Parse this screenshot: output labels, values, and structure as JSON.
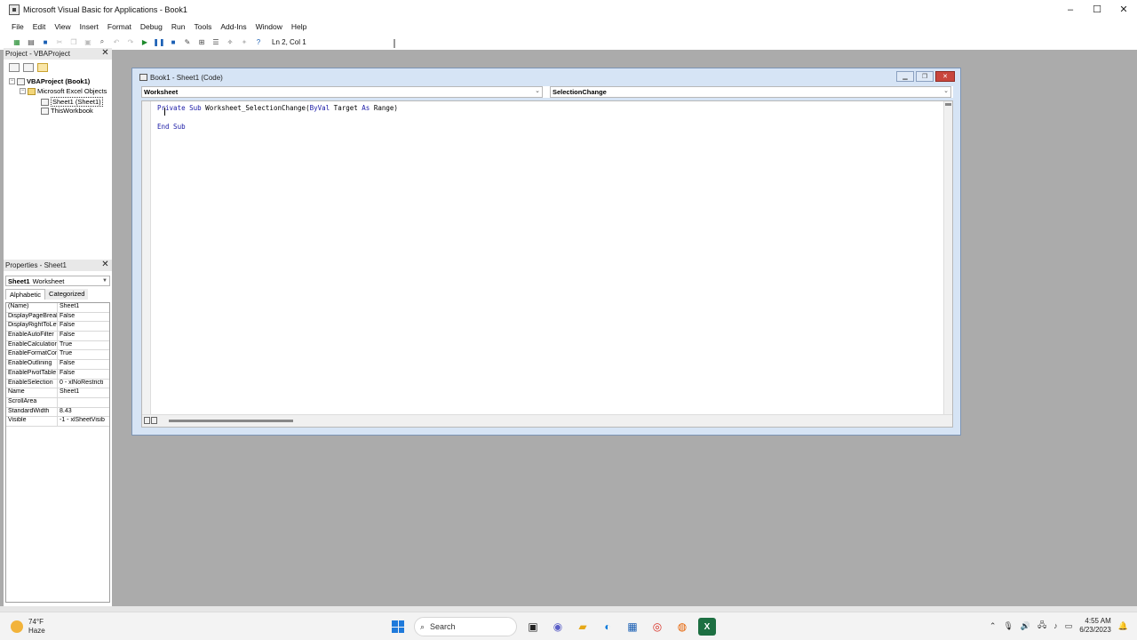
{
  "window": {
    "title": "Microsoft Visual Basic for Applications - Book1",
    "controls": [
      "–",
      "☐",
      "✕"
    ]
  },
  "menu": [
    "File",
    "Edit",
    "View",
    "Insert",
    "Format",
    "Debug",
    "Run",
    "Tools",
    "Add-Ins",
    "Window",
    "Help"
  ],
  "toolbar": {
    "status": "Ln 2, Col 1"
  },
  "project": {
    "title": "Project - VBAProject",
    "tree": {
      "root": "VBAProject (Book1)",
      "folder": "Microsoft Excel Objects",
      "items": [
        "Sheet1 (Sheet1)",
        "ThisWorkbook"
      ]
    }
  },
  "properties": {
    "title": "Properties - Sheet1",
    "object_name": "Sheet1",
    "object_type": "Worksheet",
    "tabs": [
      "Alphabetic",
      "Categorized"
    ],
    "rows": [
      {
        "name": "(Name)",
        "value": "Sheet1"
      },
      {
        "name": "DisplayPageBreak",
        "value": "False"
      },
      {
        "name": "DisplayRightToLef",
        "value": "False"
      },
      {
        "name": "EnableAutoFilter",
        "value": "False"
      },
      {
        "name": "EnableCalculation",
        "value": "True"
      },
      {
        "name": "EnableFormatCon",
        "value": "True"
      },
      {
        "name": "EnableOutlining",
        "value": "False"
      },
      {
        "name": "EnablePivotTable",
        "value": "False"
      },
      {
        "name": "EnableSelection",
        "value": "0 - xlNoRestricti"
      },
      {
        "name": "Name",
        "value": "Sheet1"
      },
      {
        "name": "ScrollArea",
        "value": ""
      },
      {
        "name": "StandardWidth",
        "value": "8.43"
      },
      {
        "name": "Visible",
        "value": "-1 - xlSheetVisib"
      }
    ]
  },
  "code_window": {
    "title": "Book1 - Sheet1 (Code)",
    "object_combo": "Worksheet",
    "procedure_combo": "SelectionChange",
    "line1_kw1": "Private Sub",
    "line1_rest": " Worksheet_SelectionChange(",
    "line1_kw2": "ByVal",
    "line1_mid": " Target ",
    "line1_kw3": "As",
    "line1_end": " Range)",
    "line3": "End Sub"
  },
  "taskbar": {
    "temperature": "74°F",
    "condition": "Haze",
    "search_label": "Search",
    "time": "4:55 AM",
    "date": "6/23/2023"
  },
  "colors": {
    "keyword": "#1a1aa6",
    "code_window_frame": "#d6e4f5",
    "mdi_background": "#ababab"
  }
}
